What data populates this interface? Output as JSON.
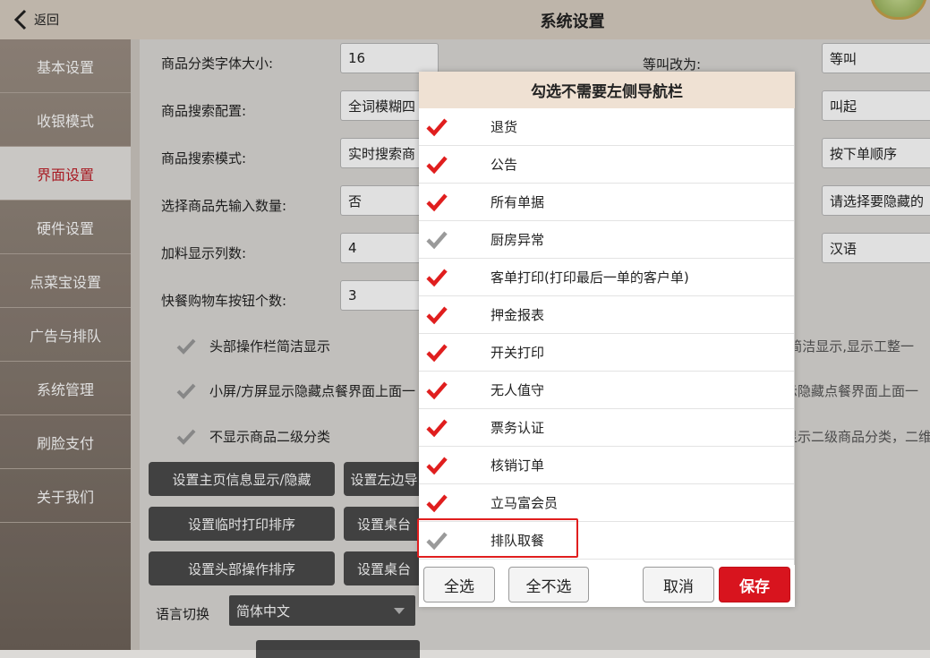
{
  "header": {
    "back_label": "返回",
    "title": "系统设置"
  },
  "sidebar": {
    "items": [
      {
        "label": "基本设置"
      },
      {
        "label": "收银模式"
      },
      {
        "label": "界面设置"
      },
      {
        "label": "硬件设置"
      },
      {
        "label": "点菜宝设置"
      },
      {
        "label": "广告与排队"
      },
      {
        "label": "系统管理"
      },
      {
        "label": "刷脸支付"
      },
      {
        "label": "关于我们"
      }
    ],
    "active": "界面设置"
  },
  "main": {
    "fields": [
      {
        "label": "商品分类字体大小:",
        "value": "16"
      },
      {
        "label": "商品搜索配置:",
        "value": "全词模糊四"
      },
      {
        "label": "商品搜索模式:",
        "value": "实时搜索商"
      },
      {
        "label": "选择商品先输入数量:",
        "value": "否"
      },
      {
        "label": "加料显示列数:",
        "value": "4"
      },
      {
        "label": "快餐购物车按钮个数:",
        "value": "3"
      }
    ],
    "right_fields": [
      {
        "label": "等叫改为:",
        "value": "等叫"
      },
      {
        "value": "叫起"
      },
      {
        "value": "按下单顺序"
      },
      {
        "value": "请选择要隐藏的"
      },
      {
        "value": "汉语"
      }
    ],
    "checks": [
      {
        "label": "头部操作栏简洁显示",
        "right": "f简洁显示,显示工整一"
      },
      {
        "label": "小屏/方屏显示隐藏点餐界面上面一",
        "right": "示隐藏点餐界面上面一"
      },
      {
        "label": "不显示商品二级分类",
        "right": "显示二级商品分类，二维"
      }
    ],
    "buttons": [
      "设置主页信息显示/隐藏",
      "设置左边导",
      "设置临时打印排序",
      "设置桌台",
      "设置头部操作排序",
      "设置桌台"
    ],
    "language_label": "语言切换",
    "language_value": "简体中文"
  },
  "modal": {
    "title": "勾选不需要左侧导航栏",
    "items": [
      {
        "label": "退货",
        "checked": true
      },
      {
        "label": "公告",
        "checked": true
      },
      {
        "label": "所有单据",
        "checked": true
      },
      {
        "label": "厨房异常",
        "checked": false
      },
      {
        "label": "客单打印(打印最后一单的客户单)",
        "checked": true
      },
      {
        "label": "押金报表",
        "checked": true
      },
      {
        "label": "开关打印",
        "checked": true
      },
      {
        "label": "无人值守",
        "checked": true
      },
      {
        "label": "票务认证",
        "checked": true
      },
      {
        "label": "核销订单",
        "checked": true
      },
      {
        "label": "立马富会员",
        "checked": true
      },
      {
        "label": "排队取餐",
        "checked": false
      }
    ],
    "select_all": "全选",
    "select_none": "全不选",
    "cancel": "取消",
    "save": "保存"
  },
  "colors": {
    "checked": "#e01e1e",
    "unchecked": "#9a9a9a",
    "save": "#d8141e",
    "active_nav": "#c0202a"
  }
}
